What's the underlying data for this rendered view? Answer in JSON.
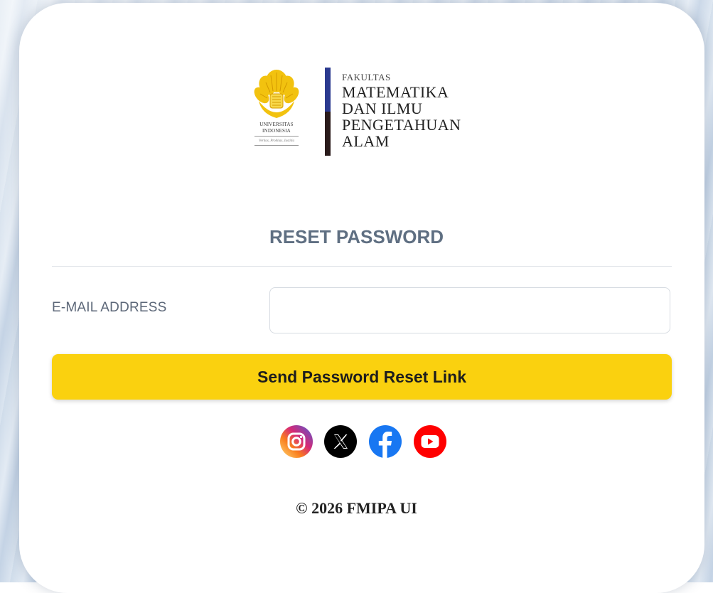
{
  "logo": {
    "seal_line1": "UNIVERSITAS",
    "seal_line2": "INDONESIA",
    "seal_motto": "Veritas, Probitas, Iustitia",
    "faculty_small": "FAKULTAS",
    "faculty_lines": [
      "MATEMATIKA",
      "DAN ILMU",
      "PENGETAHUAN",
      "ALAM"
    ],
    "colors": {
      "seal": "#f2c20f",
      "bar_top": "#2b3a8f",
      "bar_bottom": "#2a1b1b"
    }
  },
  "form": {
    "title": "RESET PASSWORD",
    "email_label": "E-MAIL ADDRESS",
    "email_value": "",
    "email_placeholder": "",
    "submit_label": "Send Password Reset Link"
  },
  "socials": [
    {
      "name": "instagram-icon"
    },
    {
      "name": "x-icon"
    },
    {
      "name": "facebook-icon"
    },
    {
      "name": "youtube-icon"
    }
  ],
  "footer": {
    "copyright": "© 2026 FMIPA UI"
  },
  "theme": {
    "accent": "#fad10f",
    "title_color": "#5f6f82"
  }
}
